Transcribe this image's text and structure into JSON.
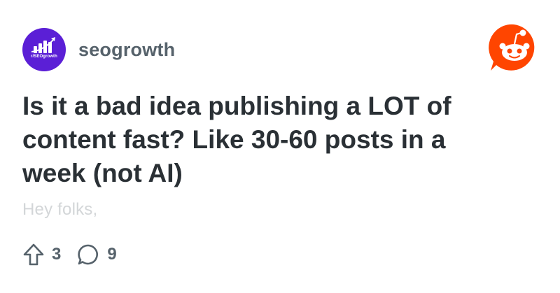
{
  "subreddit": {
    "name": "seogrowth",
    "avatar_label": "r/SEOgrowth",
    "avatar_color": "#5b1fd6",
    "avatar_icon": "bar-chart-growth-icon"
  },
  "app_logo": {
    "icon": "reddit-snoo-icon",
    "color": "#ff4500"
  },
  "post": {
    "title": "Is it a bad idea publishing a LOT of content fast? Like 30-60 posts in a week (not AI)",
    "body_preview": "Hey folks,"
  },
  "stats": {
    "upvotes": "3",
    "comments": "9",
    "upvote_icon": "upvote-arrow-icon",
    "comment_icon": "comment-bubble-icon"
  }
}
